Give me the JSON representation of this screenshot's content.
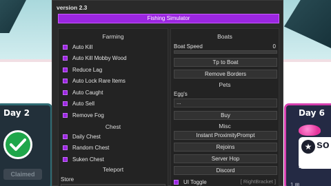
{
  "scene": {
    "left_card": {
      "title": "Day 2",
      "status": "Claimed",
      "icon": "checkmark-icon"
    },
    "right_card": {
      "title": "Day 6",
      "promo_text": "so",
      "promo_url": "main.lu",
      "footer": "1 ⊞"
    }
  },
  "window": {
    "version": "version 2.3",
    "title": "Fishing Simulator",
    "accent_color": "#9b26e1"
  },
  "left": {
    "farming": {
      "title": "Farming",
      "items": [
        "Auto Kill",
        "Auto Kill Mobby Wood",
        "Reduce Lag",
        "Auto Lock Rare Items",
        "Auto Caught",
        "Auto Sell",
        "Remove Fog"
      ]
    },
    "chest": {
      "title": "Chest",
      "items": [
        "Daily Chest",
        "Random Chest",
        "Suken Chest"
      ]
    },
    "teleport": {
      "title": "Teleport",
      "store_label": "Store",
      "store_value": ""
    }
  },
  "right": {
    "boats": {
      "title": "Boats",
      "slider_label": "Boat Speed",
      "slider_value": "0",
      "buttons": [
        "Tp to Boat",
        "Remove Borders"
      ]
    },
    "pets": {
      "title": "Pets",
      "egg_label": "Egg's",
      "egg_value": "...",
      "buy_button": "Buy"
    },
    "misc": {
      "title": "Misc",
      "buttons": [
        "Instant ProximityPrompt",
        "Rejoins",
        "Server Hop",
        "Discord"
      ]
    },
    "ui_toggle": {
      "label": "UI Toggle",
      "keybind": "[ RightBracket ]"
    }
  }
}
